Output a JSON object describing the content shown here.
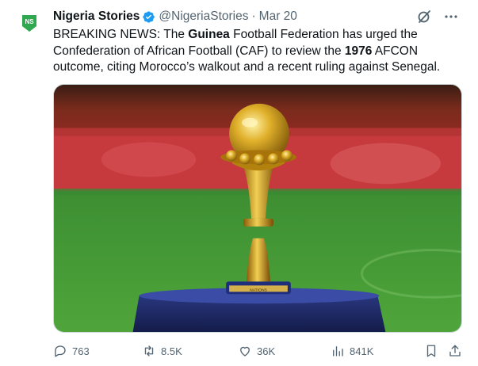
{
  "tweet": {
    "author_name": "Nigeria Stories",
    "handle": "@NigeriaStories",
    "separator": "·",
    "date": "Mar 20",
    "text_parts": [
      "BREAKING NEWS: The ",
      "Guinea",
      " Football Federation has urged the Confederation of African Football (CAF) to review the ",
      "1976",
      " AFCON outcome, citing Morocco’s walkout and a recent ruling against Senegal."
    ],
    "avatar_text": "NS",
    "trophy_base_text": "NATIONS"
  },
  "metrics": {
    "replies": "763",
    "reposts": "8.5K",
    "likes": "36K",
    "views": "841K"
  },
  "icons": {
    "verified": "verified-badge-icon",
    "grok": "grok-icon",
    "more": "more-icon",
    "reply": "reply-icon",
    "repost": "repost-icon",
    "like": "like-icon",
    "views": "views-icon",
    "bookmark": "bookmark-icon",
    "share": "share-icon"
  },
  "colors": {
    "accent": "#1d9bf0",
    "text": "#0f1419",
    "muted": "#536471",
    "brand_green": "#2fa84f"
  }
}
